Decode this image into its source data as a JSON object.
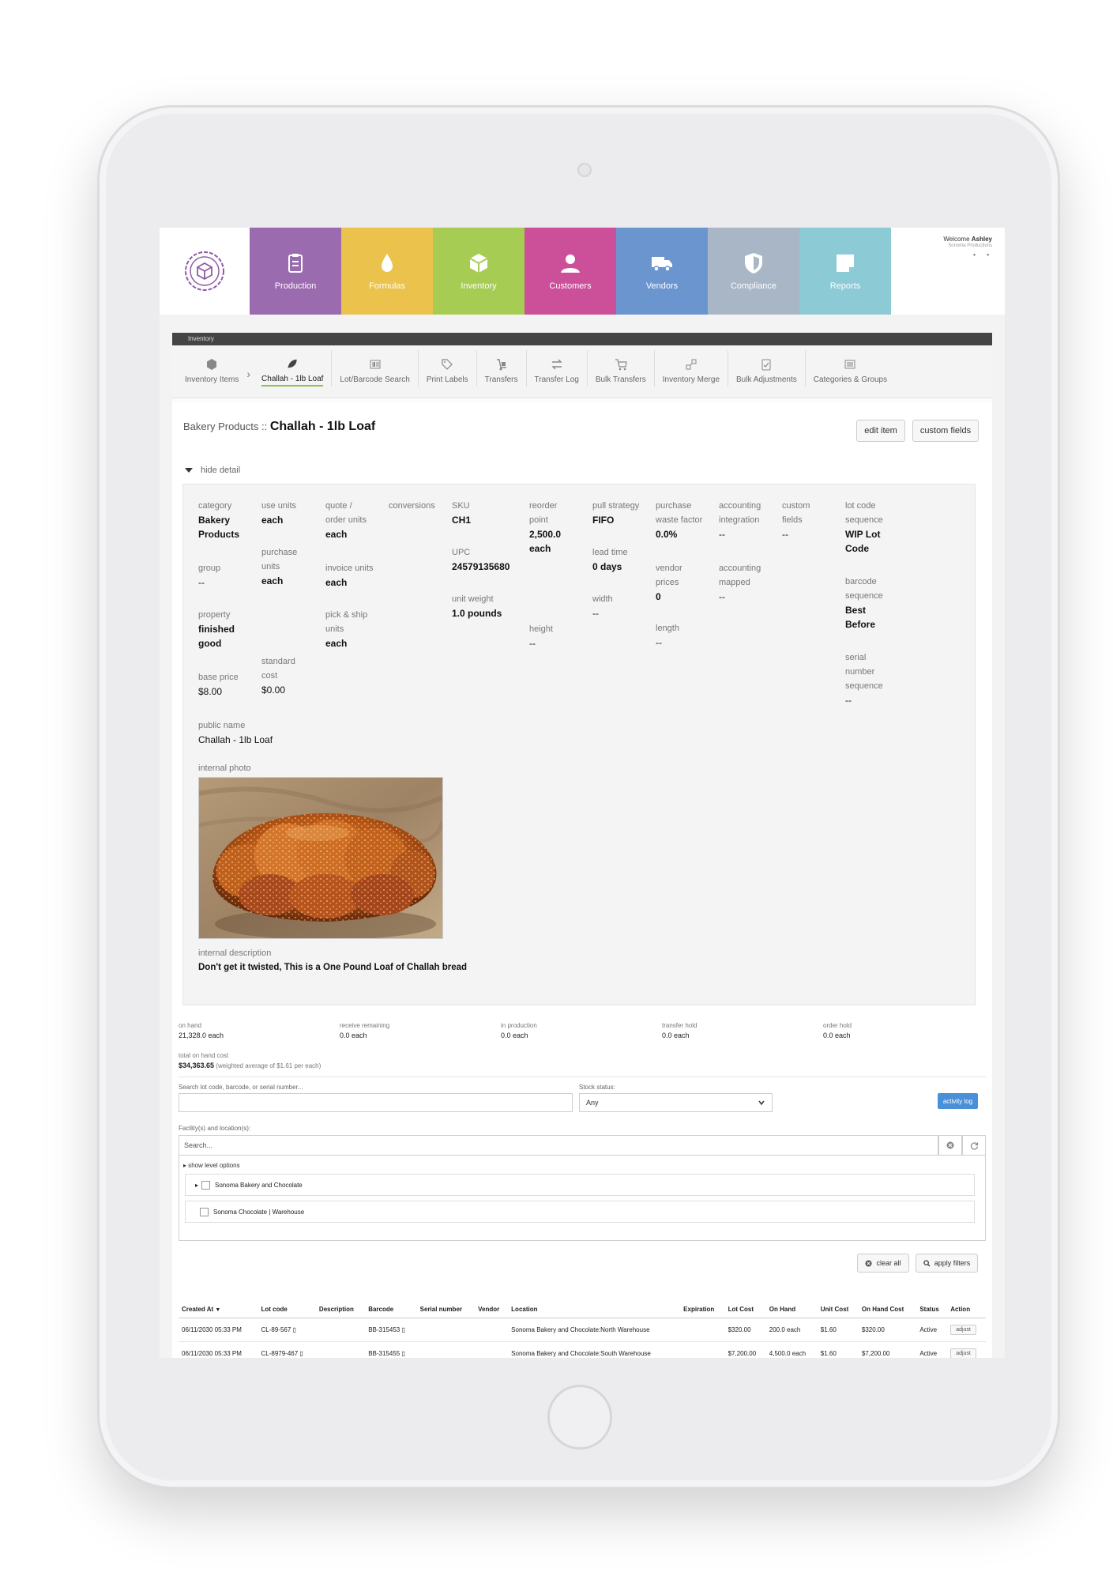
{
  "nav": {
    "tiles": [
      {
        "label": "Production",
        "icon": "clipboard-icon",
        "color": "#9b6bb0"
      },
      {
        "label": "Formulas",
        "icon": "drop-icon",
        "color": "#ebc24b"
      },
      {
        "label": "Inventory",
        "icon": "box-icon",
        "color": "#a6cc54"
      },
      {
        "label": "Customers",
        "icon": "user-icon",
        "color": "#cc4f9a"
      },
      {
        "label": "Vendors",
        "icon": "truck-icon",
        "color": "#6b95cf"
      },
      {
        "label": "Compliance",
        "icon": "shield-icon",
        "color": "#a8b6c6"
      },
      {
        "label": "Reports",
        "icon": "note-icon",
        "color": "#8ccad5"
      }
    ],
    "welcome_prefix": "Welcome",
    "welcome_user": "Ashley",
    "company": "Sonoma Productions",
    "menu_dots": "• •"
  },
  "module": {
    "title": "Inventory",
    "subnav": [
      {
        "label": "Inventory Items",
        "icon": "box-icon"
      },
      {
        "label": "Challah - 1lb Loaf",
        "icon": "leaf-icon"
      },
      {
        "label": "Lot/Barcode Search",
        "icon": "barcode-icon"
      },
      {
        "label": "Print Labels",
        "icon": "tag-icon"
      },
      {
        "label": "Transfers",
        "icon": "dolly-icon"
      },
      {
        "label": "Transfer Log",
        "icon": "arrows-icon"
      },
      {
        "label": "Bulk Transfers",
        "icon": "cart-icon"
      },
      {
        "label": "Inventory Merge",
        "icon": "merge-icon"
      },
      {
        "label": "Bulk Adjustments",
        "icon": "clipboard-check-icon"
      },
      {
        "label": "Categories & Groups",
        "icon": "list-icon"
      }
    ],
    "crumb_sep": "›"
  },
  "item": {
    "category_path": "Bakery Products ::",
    "name": "Challah - 1lb Loaf",
    "edit_label": "edit item",
    "custom_fields_label": "custom fields",
    "hide_detail_label": "hide detail"
  },
  "details": {
    "category": {
      "label": "category",
      "value": [
        "Bakery",
        "Products"
      ]
    },
    "group": {
      "label": "group",
      "value": "--"
    },
    "property": {
      "label": "property",
      "value": [
        "finished",
        "good"
      ]
    },
    "base_price": {
      "label": "base price",
      "value": "$8.00"
    },
    "use_units": {
      "label": "use units",
      "value": "each"
    },
    "purchase_units": {
      "label": [
        "purchase",
        "units"
      ],
      "value": "each"
    },
    "standard_cost": {
      "label": [
        "standard",
        "cost"
      ],
      "value": "$0.00"
    },
    "quote_units": {
      "label": [
        "quote /",
        "order units"
      ],
      "value": "each"
    },
    "invoice_units": {
      "label": "invoice units",
      "value": "each"
    },
    "pick_ship_units": {
      "label": [
        "pick & ship",
        "units"
      ],
      "value": "each"
    },
    "conversions": {
      "label": "conversions"
    },
    "sku": {
      "label": "SKU",
      "value": "CH1"
    },
    "upc": {
      "label": "UPC",
      "value": "24579135680"
    },
    "unit_weight": {
      "label": "unit weight",
      "value": "1.0 pounds"
    },
    "reorder_point": {
      "label": [
        "reorder",
        "point"
      ],
      "value": [
        "2,500.0",
        "each"
      ]
    },
    "height": {
      "label": "height",
      "value": "--"
    },
    "pull_strategy": {
      "label": "pull strategy",
      "value": "FIFO"
    },
    "lead_time": {
      "label": "lead time",
      "value": "0 days"
    },
    "width": {
      "label": "width",
      "value": "--"
    },
    "purchase_waste": {
      "label": [
        "purchase",
        "waste factor"
      ],
      "value": "0.0%"
    },
    "vendor_prices": {
      "label": [
        "vendor",
        "prices"
      ],
      "value": "0"
    },
    "length": {
      "label": "length",
      "value": "--"
    },
    "accounting_integration": {
      "label": [
        "accounting",
        "integration"
      ],
      "value": "--"
    },
    "accounting_mapped": {
      "label": [
        "accounting",
        "mapped"
      ],
      "value": "--"
    },
    "custom_fields": {
      "label": [
        "custom",
        "fields"
      ],
      "value": "--"
    },
    "lot_code_sequence": {
      "label": [
        "lot code",
        "sequence"
      ],
      "value": [
        "WIP Lot",
        "Code"
      ]
    },
    "barcode_sequence": {
      "label": [
        "barcode",
        "sequence"
      ],
      "value": [
        "Best",
        "Before"
      ]
    },
    "serial_sequence": {
      "label": [
        "serial",
        "number",
        "sequence"
      ],
      "value": "--"
    },
    "public_name": {
      "label": "public name",
      "value": "Challah - 1lb Loaf"
    },
    "internal_photo": {
      "label": "internal photo"
    },
    "internal_description": {
      "label": "internal description",
      "value": "Don't get it twisted, This is a One Pound Loaf of Challah bread"
    }
  },
  "stats": [
    {
      "label": "on hand",
      "value": "21,328.0 each"
    },
    {
      "label": "receive remaining",
      "value": "0.0 each"
    },
    {
      "label": "in production",
      "value": "0.0 each"
    },
    {
      "label": "transfer hold",
      "value": "0.0 each"
    },
    {
      "label": "order hold",
      "value": "0.0 each"
    }
  ],
  "total_on_hand": {
    "label": "total on hand cost",
    "value": "$34,363.65",
    "note": "(weighted average of $1.61 per each)"
  },
  "search": {
    "label": "Search lot code, barcode, or serial number...",
    "stock_label": "Stock status:",
    "stock_value": "Any",
    "activity_label": "activity log",
    "facility_label": "Facility(s) and location(s):",
    "facility_placeholder": "Search...",
    "level_options": "show level options",
    "locations": [
      "Sonoma Bakery and Chocolate",
      "Sonoma Chocolate | Warehouse"
    ],
    "clear_label": "clear all",
    "apply_label": "apply filters"
  },
  "table": {
    "headers": [
      "Created At",
      "Lot code",
      "Description",
      "Barcode",
      "Serial number",
      "Vendor",
      "Location",
      "Expiration",
      "Lot Cost",
      "On Hand",
      "Unit Cost",
      "On Hand Cost",
      "Status",
      "Action"
    ],
    "rows": [
      [
        "06/11/2030 05:33 PM",
        "CL-89-567",
        "",
        "BB-315453",
        "",
        "",
        "Sonoma Bakery and Chocolate:North Warehouse",
        "",
        "$320.00",
        "200.0 each",
        "$1.60",
        "$320.00",
        "Active",
        "adjust"
      ],
      [
        "06/11/2030 05:33 PM",
        "CL-8979-467",
        "",
        "BB-315455",
        "",
        "",
        "Sonoma Bakery and Chocolate:South Warehouse",
        "",
        "$7,200.00",
        "4,500.0 each",
        "$1.60",
        "$7,200.00",
        "Active",
        "adjust"
      ]
    ],
    "sort_indicator": "▼"
  }
}
